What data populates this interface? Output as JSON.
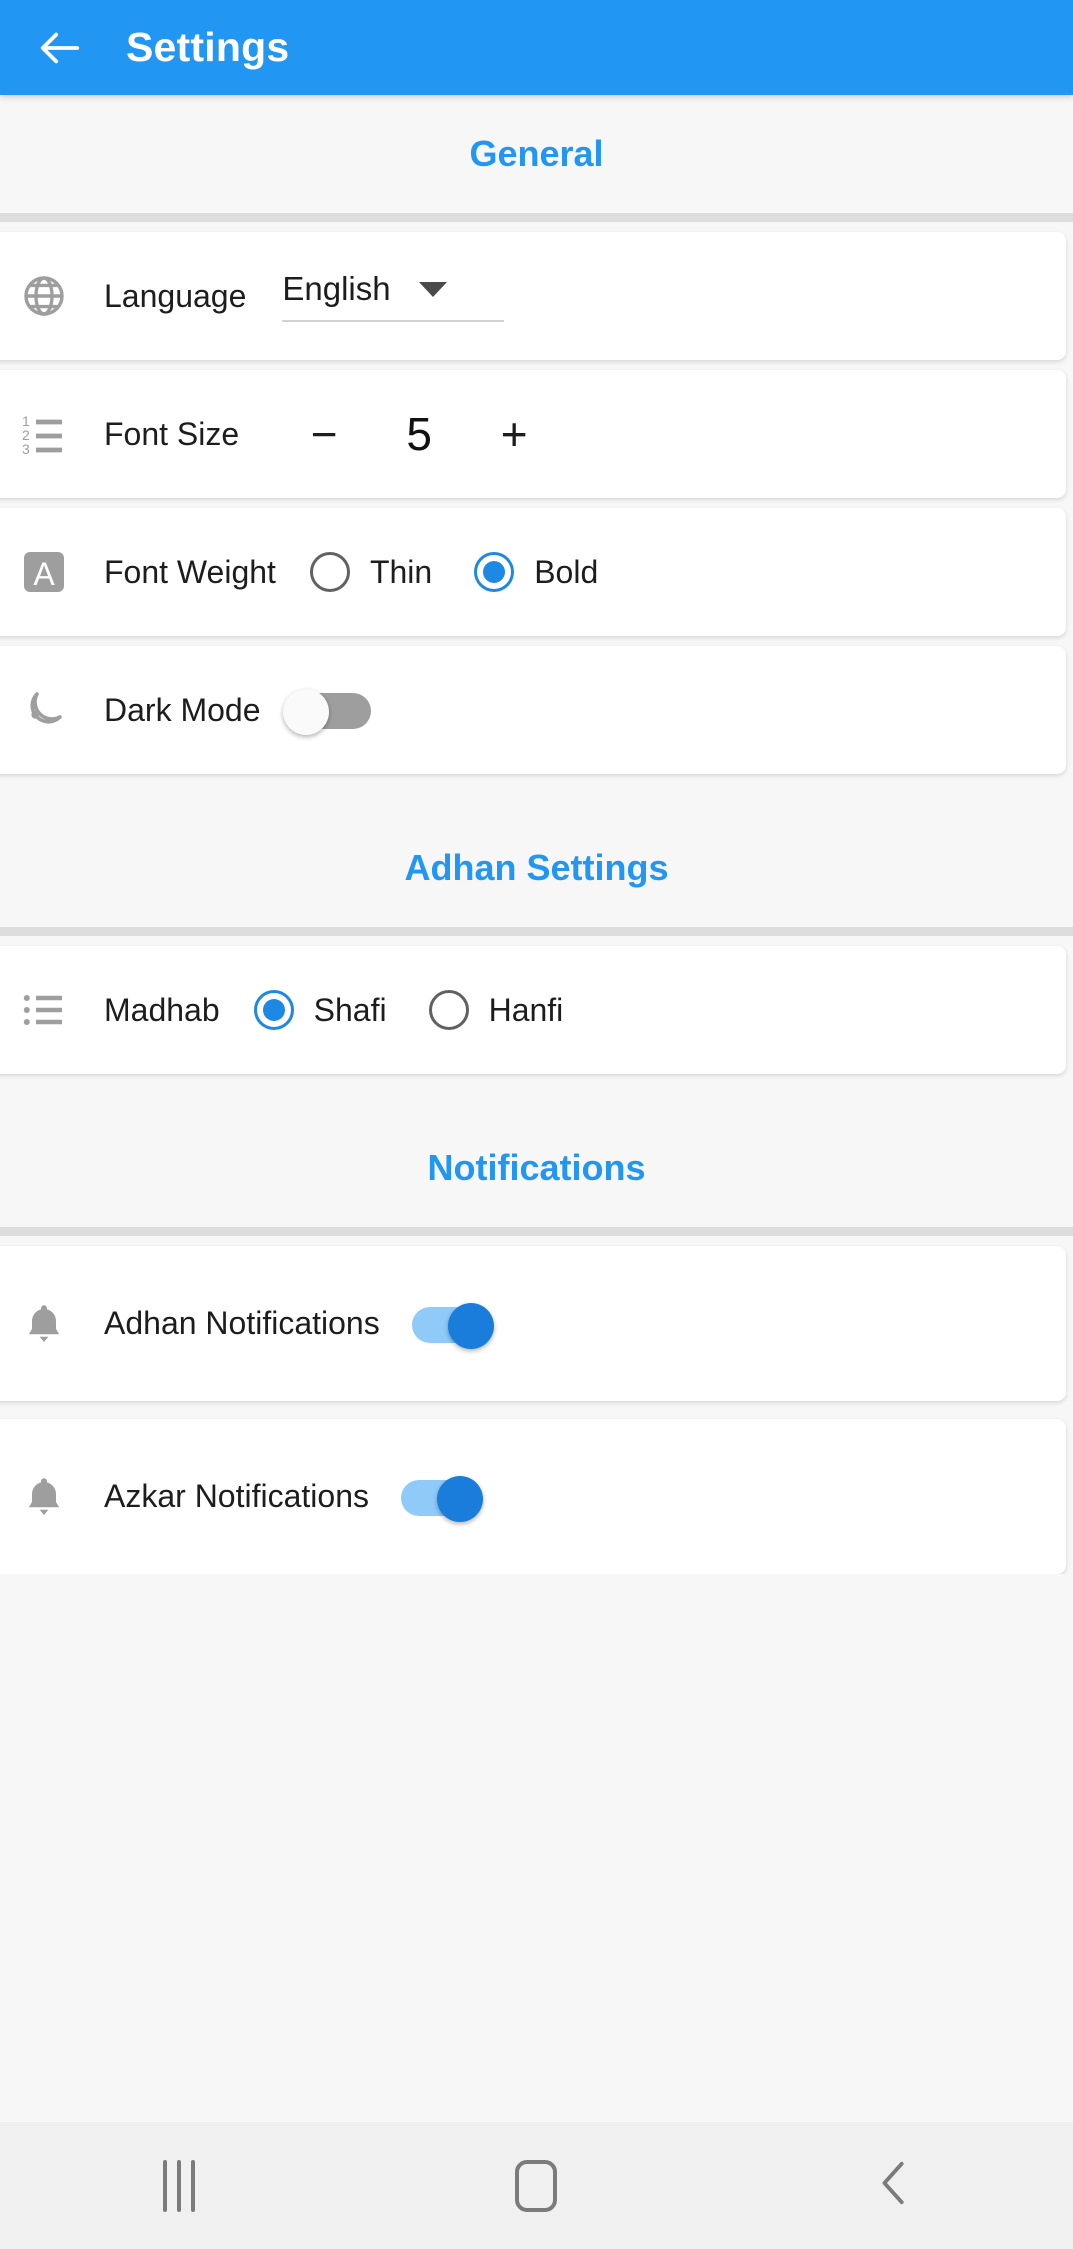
{
  "appbar": {
    "title": "Settings",
    "back_icon": "arrow-left-icon",
    "background_color": "#2196f3",
    "title_color": "#ffffff"
  },
  "accent_color": "#2196f3",
  "sections": {
    "general": {
      "title": "General",
      "rows": {
        "language": {
          "icon": "globe-icon",
          "label": "Language",
          "value": "English",
          "caret_icon": "caret-down-icon"
        },
        "font_size": {
          "icon": "numbered-list-icon",
          "label": "Font Size",
          "decrement_label": "−",
          "value": "5",
          "increment_label": "+"
        },
        "font_weight": {
          "icon": "font-letter-a-icon",
          "icon_letter": "A",
          "label": "Font Weight",
          "options": [
            {
              "label": "Thin",
              "selected": false
            },
            {
              "label": "Bold",
              "selected": true
            }
          ]
        },
        "dark_mode": {
          "icon": "moon-icon",
          "label": "Dark Mode",
          "toggle_state": "off"
        }
      }
    },
    "adhan": {
      "title": "Adhan Settings",
      "rows": {
        "madhab": {
          "icon": "bulleted-list-icon",
          "label": "Madhab",
          "options": [
            {
              "label": "Shafi",
              "selected": true
            },
            {
              "label": "Hanfi",
              "selected": false
            }
          ]
        }
      }
    },
    "notifications": {
      "title": "Notifications",
      "rows": {
        "adhan_notifications": {
          "icon": "bell-icon",
          "label": "Adhan Notifications",
          "toggle_state": "on"
        },
        "azkar_notifications": {
          "icon": "bell-icon",
          "label": "Azkar Notifications",
          "toggle_state": "on"
        }
      }
    }
  },
  "navbar": {
    "recents_icon": "recents-icon",
    "home_icon": "home-square-icon",
    "back_icon": "chevron-left-icon"
  }
}
